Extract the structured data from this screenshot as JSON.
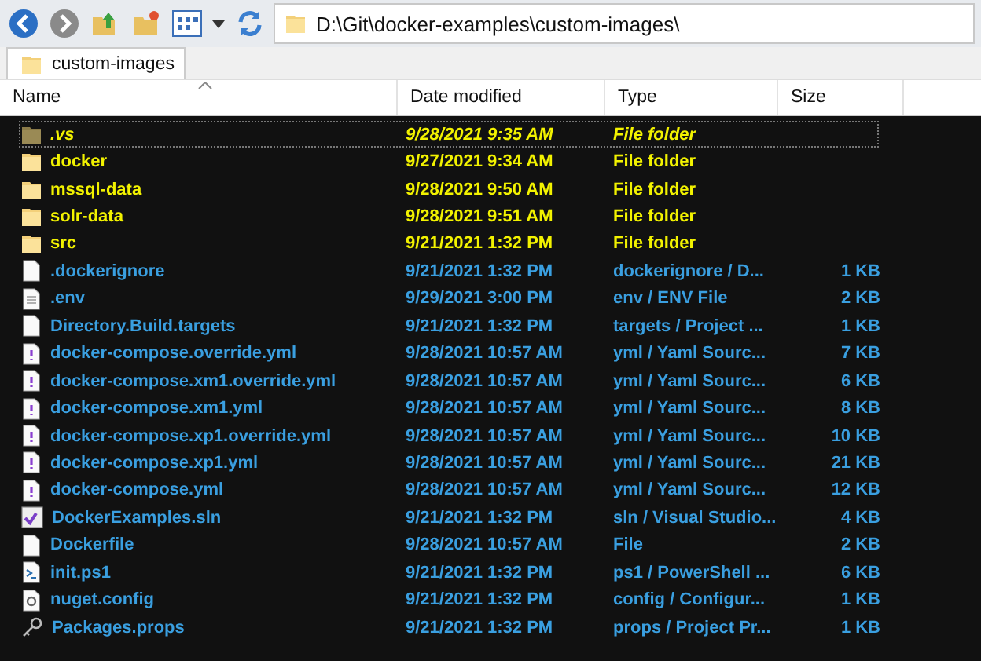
{
  "address": {
    "path": "D:\\Git\\docker-examples\\custom-images\\"
  },
  "tabs": [
    {
      "label": "custom-images",
      "selected": true
    }
  ],
  "columns": [
    {
      "label": "Name",
      "sorted": true
    },
    {
      "label": "Date modified",
      "sorted": false
    },
    {
      "label": "Type",
      "sorted": false
    },
    {
      "label": "Size",
      "sorted": false
    }
  ],
  "rows": [
    {
      "kind": "folder",
      "hidden": true,
      "focused": true,
      "name": ".vs",
      "date": "9/28/2021 9:35 AM",
      "type": "File folder"
    },
    {
      "kind": "folder",
      "hidden": false,
      "focused": false,
      "name": "docker",
      "date": "9/27/2021 9:34 AM",
      "type": "File folder"
    },
    {
      "kind": "folder",
      "hidden": false,
      "focused": false,
      "name": "mssql-data",
      "date": "9/28/2021 9:50 AM",
      "type": "File folder"
    },
    {
      "kind": "folder",
      "hidden": false,
      "focused": false,
      "name": "solr-data",
      "date": "9/28/2021 9:51 AM",
      "type": "File folder"
    },
    {
      "kind": "folder",
      "hidden": false,
      "focused": false,
      "name": "src",
      "date": "9/21/2021 1:32 PM",
      "type": "File folder"
    },
    {
      "kind": "file",
      "hidden": false,
      "focused": false,
      "name": ".dockerignore",
      "date": "9/21/2021 1:32 PM",
      "type": "dockerignore / D...",
      "size": "1 KB"
    },
    {
      "kind": "text",
      "hidden": false,
      "focused": false,
      "name": ".env",
      "date": "9/29/2021 3:00 PM",
      "type": "env / ENV File",
      "size": "2 KB"
    },
    {
      "kind": "file",
      "hidden": false,
      "focused": false,
      "name": "Directory.Build.targets",
      "date": "9/21/2021 1:32 PM",
      "type": "targets / Project ...",
      "size": "1 KB"
    },
    {
      "kind": "yaml",
      "hidden": false,
      "focused": false,
      "name": "docker-compose.override.yml",
      "date": "9/28/2021 10:57 AM",
      "type": "yml / Yaml Sourc...",
      "size": "7 KB"
    },
    {
      "kind": "yaml",
      "hidden": false,
      "focused": false,
      "name": "docker-compose.xm1.override.yml",
      "date": "9/28/2021 10:57 AM",
      "type": "yml / Yaml Sourc...",
      "size": "6 KB"
    },
    {
      "kind": "yaml",
      "hidden": false,
      "focused": false,
      "name": "docker-compose.xm1.yml",
      "date": "9/28/2021 10:57 AM",
      "type": "yml / Yaml Sourc...",
      "size": "8 KB"
    },
    {
      "kind": "yaml",
      "hidden": false,
      "focused": false,
      "name": "docker-compose.xp1.override.yml",
      "date": "9/28/2021 10:57 AM",
      "type": "yml / Yaml Sourc...",
      "size": "10 KB"
    },
    {
      "kind": "yaml",
      "hidden": false,
      "focused": false,
      "name": "docker-compose.xp1.yml",
      "date": "9/28/2021 10:57 AM",
      "type": "yml / Yaml Sourc...",
      "size": "21 KB"
    },
    {
      "kind": "yaml",
      "hidden": false,
      "focused": false,
      "name": "docker-compose.yml",
      "date": "9/28/2021 10:57 AM",
      "type": "yml / Yaml Sourc...",
      "size": "12 KB"
    },
    {
      "kind": "solution",
      "hidden": false,
      "focused": false,
      "name": "DockerExamples.sln",
      "date": "9/21/2021 1:32 PM",
      "type": "sln / Visual Studio...",
      "size": "4 KB"
    },
    {
      "kind": "file",
      "hidden": false,
      "focused": false,
      "name": "Dockerfile",
      "date": "9/28/2021 10:57 AM",
      "type": "File",
      "size": "2 KB"
    },
    {
      "kind": "script",
      "hidden": false,
      "focused": false,
      "name": "init.ps1",
      "date": "9/21/2021 1:32 PM",
      "type": "ps1 / PowerShell ...",
      "size": "6 KB"
    },
    {
      "kind": "config",
      "hidden": false,
      "focused": false,
      "name": "nuget.config",
      "date": "9/21/2021 1:32 PM",
      "type": "config / Configur...",
      "size": "1 KB"
    },
    {
      "kind": "props",
      "hidden": false,
      "focused": false,
      "name": "Packages.props",
      "date": "9/21/2021 1:32 PM",
      "type": "props / Project Pr...",
      "size": "1 KB"
    }
  ]
}
